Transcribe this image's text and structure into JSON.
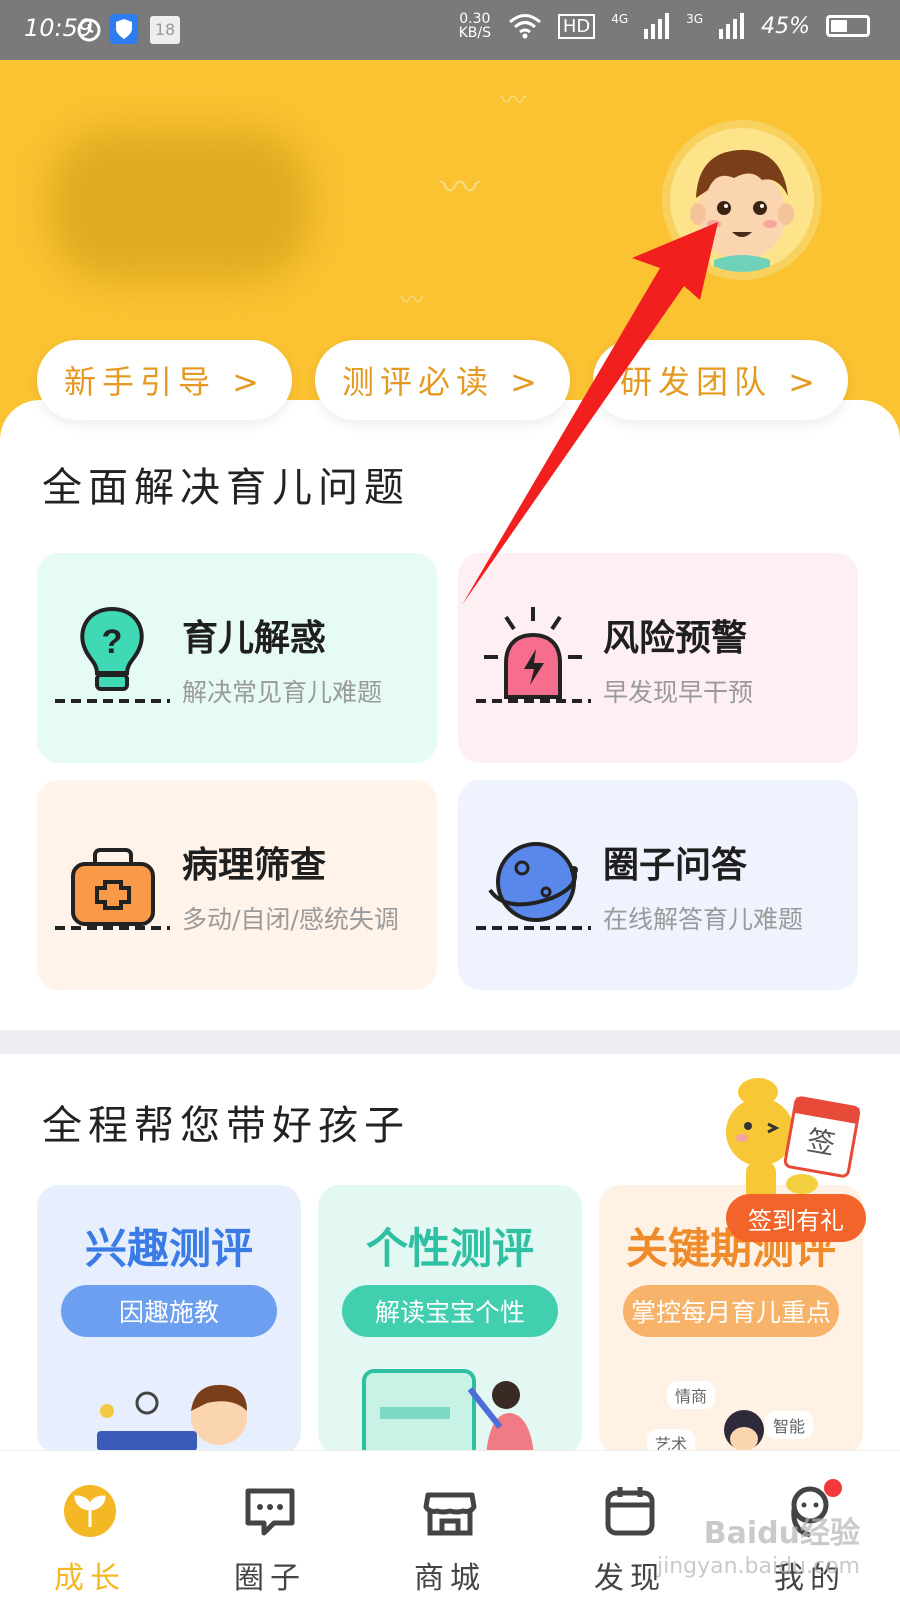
{
  "statusbar": {
    "time": "10:59",
    "speed": "0.30 KB/S",
    "hd": "HD",
    "net1": "4G",
    "net2": "3G",
    "battery": "45%",
    "battery_level": 0.45,
    "notification_count": "18"
  },
  "header": {
    "pills": [
      {
        "label": "新手引导 >"
      },
      {
        "label": "测评必读 >"
      },
      {
        "label": "研发团队 >"
      }
    ]
  },
  "section1": {
    "title": "全面解决育儿问题",
    "cards": [
      {
        "title": "育儿解惑",
        "subtitle": "解决常见育儿难题",
        "icon": "lightbulb-question-icon",
        "bg": "#e6faf6"
      },
      {
        "title": "风险预警",
        "subtitle": "早发现早干预",
        "icon": "alarm-light-icon",
        "bg": "#fef0f2"
      },
      {
        "title": "病理筛查",
        "subtitle": "多动/自闭/感统失调",
        "icon": "medical-kit-icon",
        "bg": "#fff3ea"
      },
      {
        "title": "圈子问答",
        "subtitle": "在线解答育儿难题",
        "icon": "planet-icon",
        "bg": "#eef3fd"
      }
    ]
  },
  "section2": {
    "title": "全程帮您带好孩子",
    "promos": [
      {
        "title": "兴趣测评",
        "button": "因趣施教",
        "title_color": "#3a7be6",
        "btn_color": "#6d9ff0",
        "bg": "#e7efff"
      },
      {
        "title": "个性测评",
        "button": "解读宝宝个性",
        "title_color": "#2fbfa2",
        "btn_color": "#41cfb0",
        "bg": "#e4f8f3"
      },
      {
        "title": "关键期测评",
        "button": "掌控每月育儿重点",
        "title_color": "#ef8b2a",
        "btn_color": "#f7b36a",
        "bg": "#fff2e4"
      }
    ],
    "promo_tags": [
      "情商",
      "智能",
      "艺术"
    ],
    "sign_badge": "签到有礼",
    "sign_char": "签"
  },
  "tabbar": {
    "tabs": [
      {
        "label": "成长",
        "icon": "growth-sprout-icon",
        "active": true
      },
      {
        "label": "圈子",
        "icon": "chat-bubble-icon",
        "active": false
      },
      {
        "label": "商城",
        "icon": "store-icon",
        "active": false
      },
      {
        "label": "发现",
        "icon": "calendar-icon",
        "active": false
      },
      {
        "label": "我的",
        "icon": "profile-icon",
        "active": false
      }
    ]
  },
  "watermark": {
    "line1": "Baidu经验",
    "line2": "jingyan.baidu.com"
  },
  "colors": {
    "header_bg": "#fbc332",
    "accent": "#f5b825",
    "pill_text": "#e49a22",
    "arrow": "#f21f1f"
  }
}
